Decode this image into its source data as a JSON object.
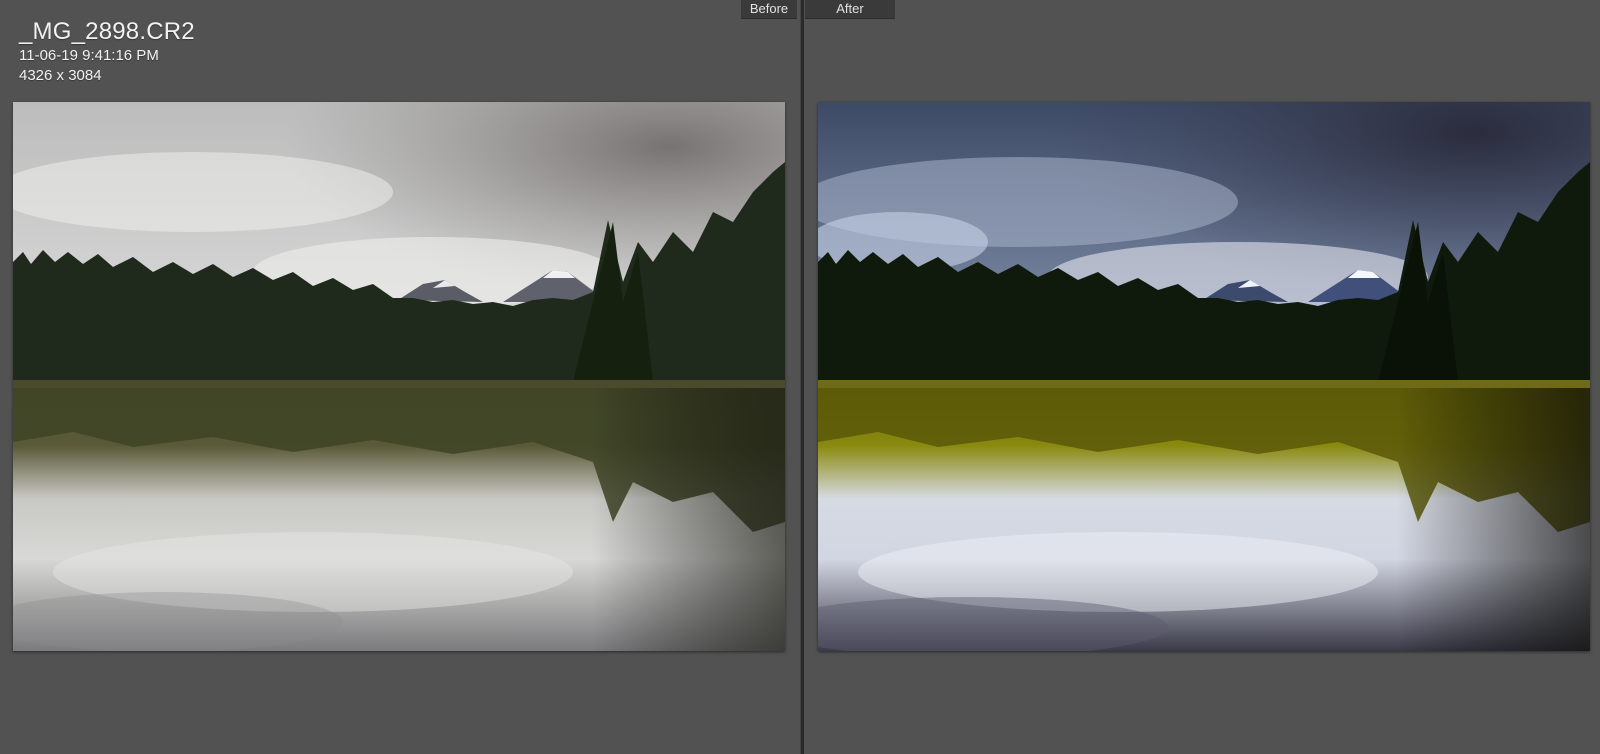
{
  "panes": {
    "before": {
      "label": "Before"
    },
    "after": {
      "label": "After"
    }
  },
  "info": {
    "filename": "_MG_2898.CR2",
    "datetime": "11-06-19 9:41:16 PM",
    "dimensions": "4326 x 3084"
  },
  "colors": {
    "background": "#525252",
    "tab_background": "#3a3a3a",
    "text": "#f2f2f2"
  }
}
